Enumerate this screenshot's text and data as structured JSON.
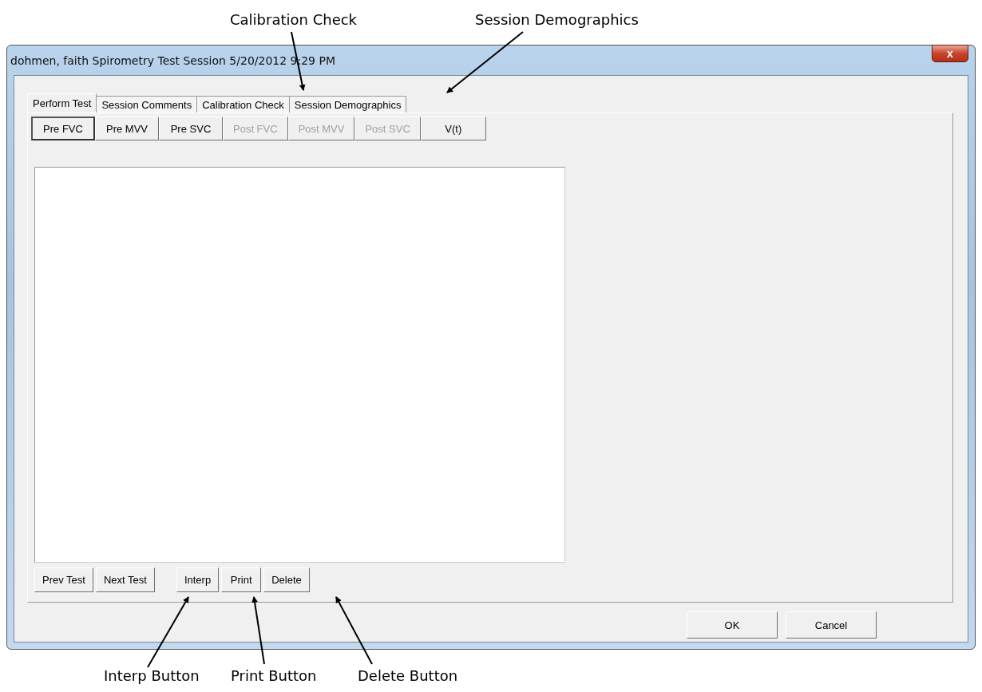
{
  "window": {
    "title": "dohmen, faith Spirometry Test Session 5/20/2012 9:29 PM",
    "close_label": "x"
  },
  "tabs": [
    {
      "label": "Perform Test",
      "selected": true
    },
    {
      "label": "Session Comments",
      "selected": false
    },
    {
      "label": "Calibration Check",
      "selected": false
    },
    {
      "label": "Session Demographics",
      "selected": false
    }
  ],
  "test_buttons": [
    {
      "label": "Pre FVC",
      "selected": true,
      "disabled": false
    },
    {
      "label": "Pre MVV",
      "selected": false,
      "disabled": false
    },
    {
      "label": "Pre SVC",
      "selected": false,
      "disabled": false
    },
    {
      "label": "Post FVC",
      "selected": false,
      "disabled": true
    },
    {
      "label": "Post MVV",
      "selected": false,
      "disabled": true
    },
    {
      "label": "Post SVC",
      "selected": false,
      "disabled": true
    },
    {
      "label": "V(t)",
      "selected": false,
      "disabled": false
    }
  ],
  "action_groups": [
    [
      "Prev Test",
      "Next Test"
    ],
    [
      "Interp",
      "Print",
      "Delete"
    ]
  ],
  "dialog_buttons": [
    "OK",
    "Cancel"
  ],
  "annotations_top": [
    "Calibration Check",
    "Session Demographics"
  ],
  "annotations_bottom": [
    "Interp Button",
    "Print Button",
    "Delete Button"
  ]
}
